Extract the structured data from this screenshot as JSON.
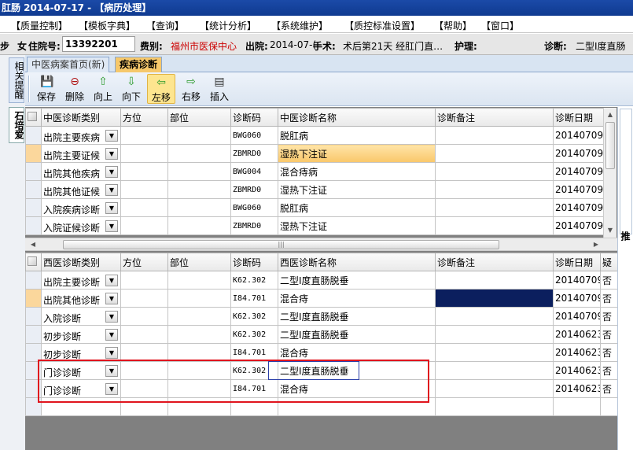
{
  "window": {
    "title": "肛肠  2014-07-17 - 【病历处理】"
  },
  "menu": [
    "【质量控制】",
    "【模板字典】",
    "【查询】",
    "【统计分析】",
    "【系统维护】",
    "【质控标准设置】",
    "【帮助】",
    "【窗口】"
  ],
  "info": {
    "bed": "步",
    "name": "女",
    "inpatient_label": "住院号:",
    "inpatient_no": "13392201",
    "fee_label": "费别:",
    "fee_value": "福州市医保中心",
    "discharge_label": "出院:",
    "discharge_value": "2014-07-(",
    "surgery_label": "手术:",
    "surgery_value": "术后第21天  经肛门直…",
    "nursing_label": "护理:",
    "diagnosis_label": "诊断:",
    "diagnosis_value": "二型Ⅰ度直肠"
  },
  "left_tabs": [
    "相关提醒",
    "石培爱"
  ],
  "tabs": [
    {
      "label": "中医病案首页(新)",
      "active": false
    },
    {
      "label": "疾病诊断",
      "active": true
    }
  ],
  "toolbar": [
    {
      "label": "保存",
      "icon": "save-icon",
      "glyph": "💾",
      "color": "#1a7a1a"
    },
    {
      "label": "删除",
      "icon": "delete-icon",
      "glyph": "⊖",
      "color": "#b01010"
    },
    {
      "label": "向上",
      "icon": "arrow-up-icon",
      "glyph": "⇧",
      "color": "#2a9a2a"
    },
    {
      "label": "向下",
      "icon": "arrow-down-icon",
      "glyph": "⇩",
      "color": "#2a9a2a"
    },
    {
      "label": "左移",
      "icon": "arrow-left-icon",
      "glyph": "⇦",
      "color": "#2a9a2a",
      "highlighted": true
    },
    {
      "label": "右移",
      "icon": "arrow-right-icon",
      "glyph": "⇨",
      "color": "#2a9a2a"
    },
    {
      "label": "插入",
      "icon": "insert-icon",
      "glyph": "▤",
      "color": "#333333"
    }
  ],
  "tcm_grid": {
    "headers": [
      "中医诊断类别",
      "方位",
      "部位",
      "诊断码",
      "中医诊断名称",
      "诊断备注",
      "诊断日期"
    ],
    "rows": [
      {
        "category": "出院主要疾病",
        "position": "",
        "site": "",
        "code": "BWG060",
        "name": "脱肛病",
        "note": "",
        "date": "20140709"
      },
      {
        "category": "出院主要证候",
        "position": "",
        "site": "",
        "code": "ZBMRD0",
        "name": "湿热下注证",
        "note": "",
        "date": "20140709"
      },
      {
        "category": "出院其他疾病",
        "position": "",
        "site": "",
        "code": "BWG004",
        "name": "混合痔病",
        "note": "",
        "date": "20140709"
      },
      {
        "category": "出院其他证候",
        "position": "",
        "site": "",
        "code": "ZBMRD0",
        "name": "湿热下注证",
        "note": "",
        "date": "20140709"
      },
      {
        "category": "入院疾病诊断",
        "position": "",
        "site": "",
        "code": "BWG060",
        "name": "脱肛病",
        "note": "",
        "date": "20140709"
      },
      {
        "category": "入院证候诊断",
        "position": "",
        "site": "",
        "code": "ZBMRD0",
        "name": "湿热下注证",
        "note": "",
        "date": "20140709"
      }
    ]
  },
  "wm_grid": {
    "headers": [
      "西医诊断类别",
      "方位",
      "部位",
      "诊断码",
      "西医诊断名称",
      "诊断备注",
      "诊断日期",
      "疑"
    ],
    "rows": [
      {
        "category": "出院主要诊断",
        "position": "",
        "site": "",
        "code": "K62.302",
        "name": "二型Ⅰ度直肠脱垂",
        "note": "",
        "date": "20140709",
        "flag": "否"
      },
      {
        "category": "出院其他诊断",
        "position": "",
        "site": "",
        "code": "I84.701",
        "name": "混合痔",
        "note": "",
        "date": "20140709",
        "flag": "否"
      },
      {
        "category": "入院诊断",
        "position": "",
        "site": "",
        "code": "K62.302",
        "name": "二型Ⅰ度直肠脱垂",
        "note": "",
        "date": "20140709",
        "flag": "否"
      },
      {
        "category": "初步诊断",
        "position": "",
        "site": "",
        "code": "K62.302",
        "name": "二型Ⅰ度直肠脱垂",
        "note": "",
        "date": "20140623",
        "flag": "否"
      },
      {
        "category": "初步诊断",
        "position": "",
        "site": "",
        "code": "I84.701",
        "name": "混合痔",
        "note": "",
        "date": "20140623",
        "flag": "否"
      },
      {
        "category": "门诊诊断",
        "position": "",
        "site": "",
        "code": "K62.302",
        "name": "二型Ⅰ度直肠脱垂",
        "note": "",
        "date": "20140623",
        "flag": "否"
      },
      {
        "category": "门诊诊断",
        "position": "",
        "site": "",
        "code": "I84.701",
        "name": "混合痔",
        "note": "",
        "date": "20140623",
        "flag": "否"
      }
    ]
  },
  "right_panel": {
    "label": "推"
  },
  "colors": {
    "titlebar": "#1b4aa8",
    "selected_cell": "#f9c76a",
    "dark_cell": "#0b1f5e",
    "highlight_box": "#e0141e",
    "fee_text": "#cc0000"
  }
}
